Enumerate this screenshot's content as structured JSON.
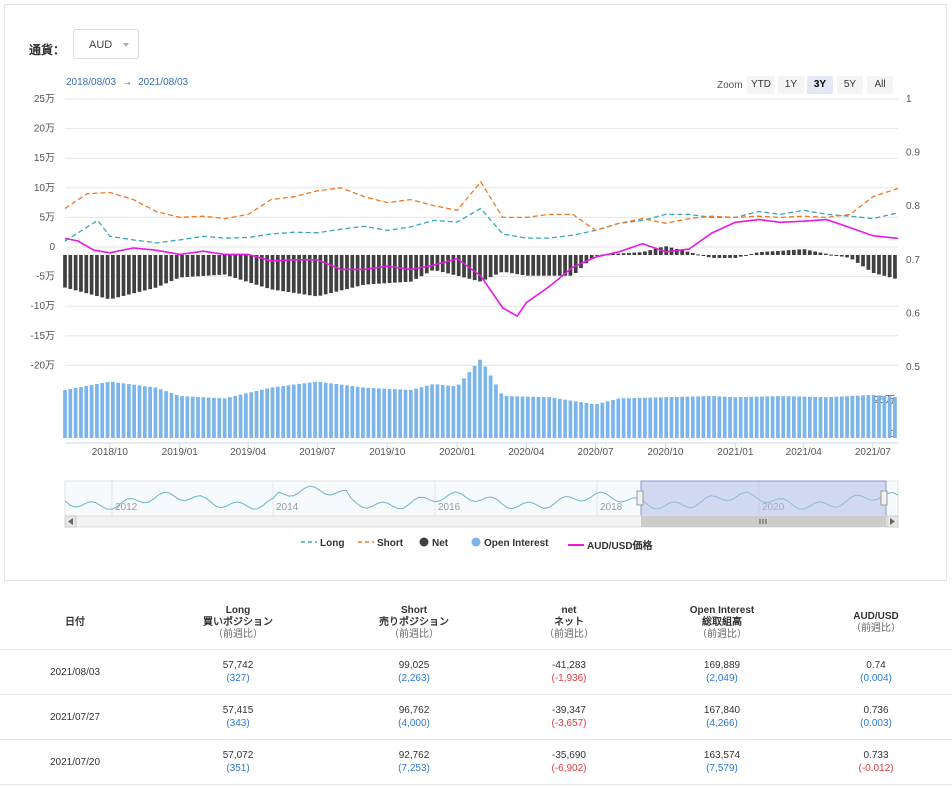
{
  "selector": {
    "label": "通貨：",
    "value": "AUD"
  },
  "date_range": {
    "from": "2018/08/03",
    "arrow": "→",
    "to": "2021/08/03"
  },
  "zoom": {
    "label": "Zoom",
    "buttons": [
      "YTD",
      "1Y",
      "3Y",
      "5Y",
      "All"
    ],
    "active": "3Y"
  },
  "legend": [
    {
      "label": "Long",
      "color": "#3ba6b8",
      "marker": "dash"
    },
    {
      "label": "Short",
      "color": "#f07823",
      "marker": "dash"
    },
    {
      "label": "Net",
      "color": "#404040",
      "marker": "dot"
    },
    {
      "label": "Open Interest",
      "color": "#7cb5ec",
      "marker": "dot"
    },
    {
      "label": "AUD/USD価格",
      "color": "#e619e6",
      "marker": "line"
    }
  ],
  "chart_data": {
    "type": "line",
    "left_axis_ticks": [
      "25万",
      "20万",
      "15万",
      "10万",
      "5万",
      "0",
      "-5万",
      "-10万",
      "-15万",
      "-20万"
    ],
    "left_axis_values": [
      250000,
      200000,
      150000,
      100000,
      50000,
      0,
      -50000,
      -100000,
      -150000,
      -200000
    ],
    "right_axis_ticks": [
      "1",
      "0.9",
      "0.8",
      "0.7",
      "0.6",
      "0.5"
    ],
    "right_axis_values": [
      1,
      0.9,
      0.8,
      0.7,
      0.6,
      0.5
    ],
    "oi_axis_ticks": [
      "25万",
      "0"
    ],
    "x_ticks": [
      "2018/10",
      "2019/01",
      "2019/04",
      "2019/07",
      "2019/10",
      "2020/01",
      "2020/04",
      "2020/07",
      "2020/10",
      "2021/01",
      "2021/04",
      "2021/07"
    ],
    "x_range": [
      "2018-08-03",
      "2021-08-03"
    ],
    "navigator_ticks": [
      "2012",
      "2014",
      "2016",
      "2018",
      "2020"
    ],
    "series": [
      {
        "name": "Long",
        "color": "#3ba6b8",
        "style": "dashed",
        "points": [
          [
            "2018-08-03",
            10000
          ],
          [
            "2018-09-15",
            45000
          ],
          [
            "2018-10-01",
            18000
          ],
          [
            "2018-11-01",
            12000
          ],
          [
            "2018-12-01",
            7000
          ],
          [
            "2019-01-01",
            12000
          ],
          [
            "2019-02-01",
            18000
          ],
          [
            "2019-03-01",
            15000
          ],
          [
            "2019-04-01",
            16000
          ],
          [
            "2019-05-01",
            22000
          ],
          [
            "2019-06-01",
            25000
          ],
          [
            "2019-07-01",
            24000
          ],
          [
            "2019-08-01",
            30000
          ],
          [
            "2019-09-01",
            35000
          ],
          [
            "2019-10-01",
            28000
          ],
          [
            "2019-11-01",
            34000
          ],
          [
            "2019-12-01",
            45000
          ],
          [
            "2020-01-01",
            42000
          ],
          [
            "2020-02-01",
            65000
          ],
          [
            "2020-03-01",
            22000
          ],
          [
            "2020-04-01",
            15000
          ],
          [
            "2020-05-01",
            15000
          ],
          [
            "2020-06-01",
            20000
          ],
          [
            "2020-07-01",
            28000
          ],
          [
            "2020-08-01",
            40000
          ],
          [
            "2020-09-01",
            45000
          ],
          [
            "2020-10-01",
            55000
          ],
          [
            "2020-11-01",
            55000
          ],
          [
            "2020-12-01",
            50000
          ],
          [
            "2021-01-01",
            50000
          ],
          [
            "2021-02-01",
            60000
          ],
          [
            "2021-03-01",
            55000
          ],
          [
            "2021-04-01",
            62000
          ],
          [
            "2021-05-01",
            55000
          ],
          [
            "2021-06-01",
            52000
          ],
          [
            "2021-07-01",
            48000
          ],
          [
            "2021-08-03",
            57742
          ]
        ]
      },
      {
        "name": "Short",
        "color": "#f07823",
        "style": "dashed",
        "points": [
          [
            "2018-08-03",
            65000
          ],
          [
            "2018-09-01",
            90000
          ],
          [
            "2018-10-01",
            92000
          ],
          [
            "2018-11-01",
            80000
          ],
          [
            "2018-12-01",
            60000
          ],
          [
            "2019-01-01",
            50000
          ],
          [
            "2019-02-01",
            52000
          ],
          [
            "2019-03-01",
            48000
          ],
          [
            "2019-04-01",
            55000
          ],
          [
            "2019-05-01",
            80000
          ],
          [
            "2019-06-01",
            85000
          ],
          [
            "2019-07-01",
            95000
          ],
          [
            "2019-08-01",
            100000
          ],
          [
            "2019-09-01",
            85000
          ],
          [
            "2019-10-01",
            75000
          ],
          [
            "2019-11-01",
            80000
          ],
          [
            "2019-12-01",
            70000
          ],
          [
            "2020-01-01",
            62000
          ],
          [
            "2020-02-01",
            110000
          ],
          [
            "2020-03-01",
            50000
          ],
          [
            "2020-04-01",
            50000
          ],
          [
            "2020-05-01",
            55000
          ],
          [
            "2020-06-01",
            55000
          ],
          [
            "2020-07-01",
            28000
          ],
          [
            "2020-08-01",
            40000
          ],
          [
            "2020-09-01",
            48000
          ],
          [
            "2020-10-01",
            40000
          ],
          [
            "2020-11-01",
            48000
          ],
          [
            "2020-12-01",
            52000
          ],
          [
            "2021-01-01",
            50000
          ],
          [
            "2021-02-01",
            52000
          ],
          [
            "2021-03-01",
            50000
          ],
          [
            "2021-04-01",
            52000
          ],
          [
            "2021-05-01",
            50000
          ],
          [
            "2021-06-01",
            55000
          ],
          [
            "2021-07-01",
            85000
          ],
          [
            "2021-08-03",
            99025
          ]
        ]
      },
      {
        "name": "AUD/USD価格",
        "color": "#e619e6",
        "style": "solid",
        "axis": "right",
        "points": [
          [
            "2018-08-03",
            0.74
          ],
          [
            "2018-08-20",
            0.735
          ],
          [
            "2018-09-10",
            0.718
          ],
          [
            "2018-10-01",
            0.713
          ],
          [
            "2018-11-01",
            0.722
          ],
          [
            "2018-12-01",
            0.718
          ],
          [
            "2019-01-01",
            0.71
          ],
          [
            "2019-02-01",
            0.716
          ],
          [
            "2019-03-01",
            0.71
          ],
          [
            "2019-04-01",
            0.71
          ],
          [
            "2019-05-01",
            0.698
          ],
          [
            "2019-06-01",
            0.7
          ],
          [
            "2019-07-01",
            0.7
          ],
          [
            "2019-08-01",
            0.682
          ],
          [
            "2019-09-01",
            0.682
          ],
          [
            "2019-10-01",
            0.688
          ],
          [
            "2019-11-01",
            0.682
          ],
          [
            "2019-12-01",
            0.69
          ],
          [
            "2020-01-01",
            0.702
          ],
          [
            "2020-02-01",
            0.67
          ],
          [
            "2020-03-01",
            0.61
          ],
          [
            "2020-03-20",
            0.595
          ],
          [
            "2020-04-01",
            0.62
          ],
          [
            "2020-05-01",
            0.65
          ],
          [
            "2020-06-01",
            0.686
          ],
          [
            "2020-07-01",
            0.705
          ],
          [
            "2020-08-01",
            0.715
          ],
          [
            "2020-09-01",
            0.73
          ],
          [
            "2020-10-01",
            0.715
          ],
          [
            "2020-11-01",
            0.72
          ],
          [
            "2020-12-01",
            0.75
          ],
          [
            "2021-01-01",
            0.77
          ],
          [
            "2021-02-01",
            0.775
          ],
          [
            "2021-03-01",
            0.77
          ],
          [
            "2021-04-01",
            0.772
          ],
          [
            "2021-05-01",
            0.775
          ],
          [
            "2021-06-01",
            0.76
          ],
          [
            "2021-07-01",
            0.745
          ],
          [
            "2021-08-03",
            0.74
          ]
        ]
      },
      {
        "name": "Net",
        "color": "#404040",
        "type": "bar",
        "points": [
          [
            "2018-08-03",
            -55000
          ],
          [
            "2018-10-01",
            -75000
          ],
          [
            "2018-12-01",
            -55000
          ],
          [
            "2019-01-01",
            -38000
          ],
          [
            "2019-03-01",
            -33000
          ],
          [
            "2019-05-01",
            -58000
          ],
          [
            "2019-07-01",
            -70000
          ],
          [
            "2019-09-01",
            -50000
          ],
          [
            "2019-11-01",
            -45000
          ],
          [
            "2019-12-01",
            -25000
          ],
          [
            "2020-02-01",
            -45000
          ],
          [
            "2020-03-01",
            -28000
          ],
          [
            "2020-04-01",
            -35000
          ],
          [
            "2020-06-01",
            -35000
          ],
          [
            "2020-07-01",
            0
          ],
          [
            "2020-09-01",
            5000
          ],
          [
            "2020-10-01",
            15000
          ],
          [
            "2020-11-01",
            5000
          ],
          [
            "2020-12-01",
            -5000
          ],
          [
            "2021-01-01",
            -5000
          ],
          [
            "2021-02-01",
            5000
          ],
          [
            "2021-03-01",
            7000
          ],
          [
            "2021-04-01",
            10000
          ],
          [
            "2021-05-01",
            2000
          ],
          [
            "2021-06-01",
            -5000
          ],
          [
            "2021-07-01",
            -30000
          ],
          [
            "2021-08-03",
            -41283
          ]
        ]
      },
      {
        "name": "Open Interest",
        "color": "#7cb5ec",
        "type": "bar",
        "points": [
          [
            "2018-08-03",
            200000
          ],
          [
            "2018-10-01",
            235000
          ],
          [
            "2018-12-01",
            210000
          ],
          [
            "2019-01-01",
            175000
          ],
          [
            "2019-03-01",
            165000
          ],
          [
            "2019-05-01",
            210000
          ],
          [
            "2019-07-01",
            235000
          ],
          [
            "2019-09-01",
            210000
          ],
          [
            "2019-11-01",
            200000
          ],
          [
            "2019-12-01",
            225000
          ],
          [
            "2020-01-01",
            215000
          ],
          [
            "2020-02-01",
            330000
          ],
          [
            "2020-03-01",
            175000
          ],
          [
            "2020-05-01",
            170000
          ],
          [
            "2020-07-01",
            140000
          ],
          [
            "2020-08-01",
            165000
          ],
          [
            "2020-10-01",
            170000
          ],
          [
            "2020-12-01",
            175000
          ],
          [
            "2021-01-01",
            170000
          ],
          [
            "2021-03-01",
            175000
          ],
          [
            "2021-05-01",
            170000
          ],
          [
            "2021-07-01",
            180000
          ],
          [
            "2021-08-03",
            169889
          ]
        ]
      }
    ]
  },
  "table": {
    "headers": [
      {
        "lines": [
          "日付"
        ],
        "sub": ""
      },
      {
        "lines": [
          "Long",
          "買いポジション"
        ],
        "sub": "（前週比）"
      },
      {
        "lines": [
          "Short",
          "売りポジション"
        ],
        "sub": "（前週比）"
      },
      {
        "lines": [
          "net",
          "ネット"
        ],
        "sub": "（前週比）"
      },
      {
        "lines": [
          "Open Interest",
          "総取組高"
        ],
        "sub": "（前週比）"
      },
      {
        "lines": [
          "AUD/USD"
        ],
        "sub": "（前週比）"
      }
    ],
    "rows": [
      {
        "date": "2021/08/03",
        "long": "57,742",
        "long_chg": "(327)",
        "long_sign": "pos",
        "short": "99,025",
        "short_chg": "(2,263)",
        "short_sign": "pos",
        "net": "-41,283",
        "net_chg": "(-1,936)",
        "net_sign": "neg",
        "oi": "169,889",
        "oi_chg": "(2,049)",
        "oi_sign": "pos",
        "price": "0.74",
        "price_chg": "(0.004)",
        "price_sign": "pos"
      },
      {
        "date": "2021/07/27",
        "long": "57,415",
        "long_chg": "(343)",
        "long_sign": "pos",
        "short": "96,762",
        "short_chg": "(4,000)",
        "short_sign": "pos",
        "net": "-39,347",
        "net_chg": "(-3,657)",
        "net_sign": "neg",
        "oi": "167,840",
        "oi_chg": "(4,266)",
        "oi_sign": "pos",
        "price": "0.736",
        "price_chg": "(0.003)",
        "price_sign": "pos"
      },
      {
        "date": "2021/07/20",
        "long": "57,072",
        "long_chg": "(351)",
        "long_sign": "pos",
        "short": "92,762",
        "short_chg": "(7,253)",
        "short_sign": "pos",
        "net": "-35,690",
        "net_chg": "(-6,902)",
        "net_sign": "neg",
        "oi": "163,574",
        "oi_chg": "(7,579)",
        "oi_sign": "pos",
        "price": "0.733",
        "price_chg": "(-0.012)",
        "price_sign": "neg"
      }
    ]
  }
}
